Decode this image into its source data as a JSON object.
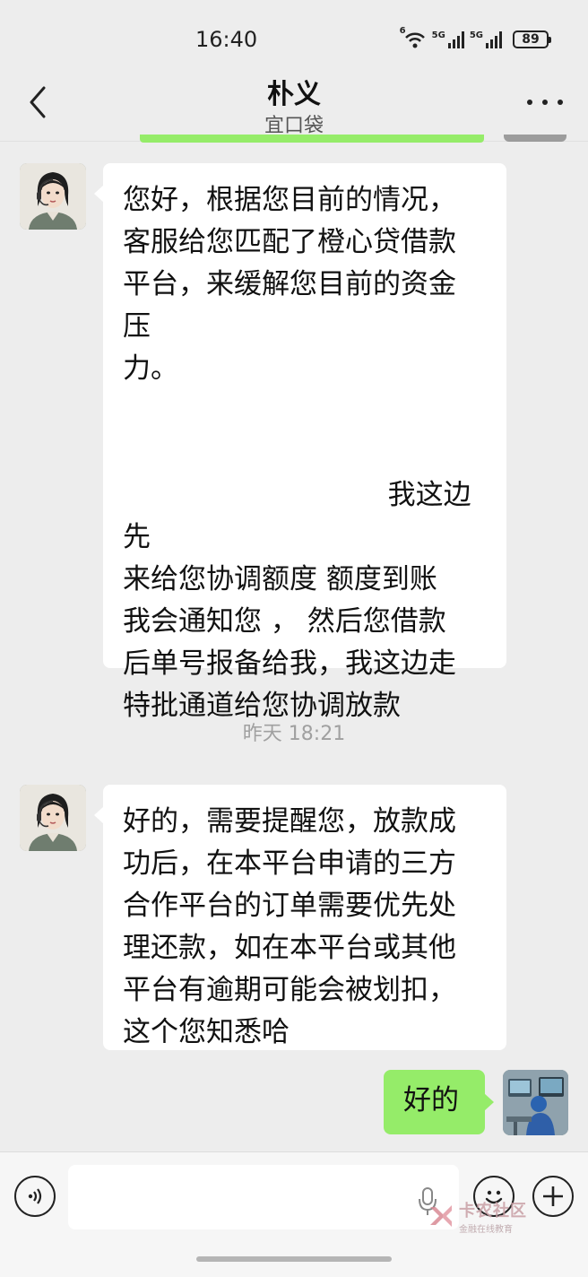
{
  "status_bar": {
    "time": "16:40",
    "network_1": "5G",
    "network_2": "5G",
    "wifi_label": "6",
    "battery": "89"
  },
  "header": {
    "title": "朴义",
    "subtitle": "宜口袋"
  },
  "messages": [
    {
      "side": "left",
      "text": "您好，根据您目前的情况，\n客服给您匹配了橙心贷借款\n平台，来缓解您目前的资金\n压\n力。\n\n\n                              我这边先\n来给您协调额度 额度到账\n我会通知您 ， 然后您借款\n后单号报备给我，我这边走\n特批通道给您协调放款"
    },
    {
      "side": "left",
      "text": "好的，需要提醒您，放款成\n功后，在本平台申请的三方\n合作平台的订单需要优先处\n理还款，如在本平台或其他\n平台有逾期可能会被划扣，\n这个您知悉哈"
    },
    {
      "side": "right",
      "text": "好的"
    }
  ],
  "timestamp": "昨天 18:21",
  "input": {
    "placeholder": ""
  },
  "watermark": {
    "main": "卡农社区",
    "sub": "金融在线教育"
  },
  "colors": {
    "background": "#ededed",
    "sent_bubble": "#95ec69",
    "received_bubble": "#ffffff"
  }
}
